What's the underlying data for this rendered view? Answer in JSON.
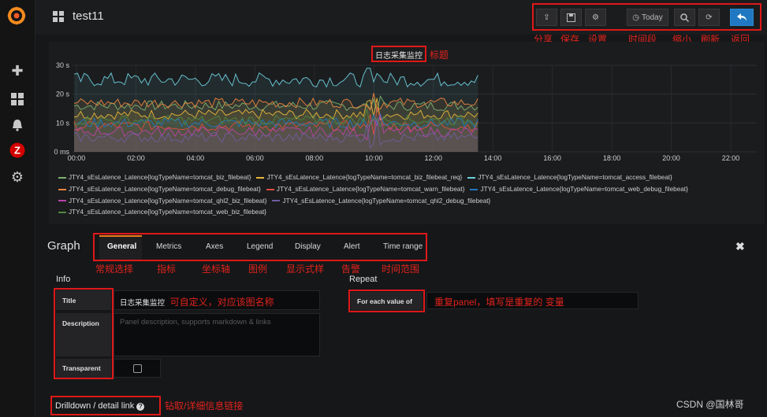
{
  "dashboard": {
    "title": "test11"
  },
  "toolbar": {
    "today_label": "Today",
    "annotations": [
      "分享",
      "保存",
      "设置",
      "时间段",
      "缩小",
      "刷新",
      "返回"
    ]
  },
  "panel": {
    "title": "日志采集监控",
    "title_annotation": "标题"
  },
  "chart_data": {
    "type": "line",
    "x": [
      "00:00",
      "02:00",
      "04:00",
      "06:00",
      "08:00",
      "10:00",
      "12:00",
      "14:00",
      "16:00",
      "18:00",
      "20:00",
      "22:00"
    ],
    "y_ticks": [
      "0 ms",
      "10 s",
      "20 s",
      "30 s"
    ],
    "ylim": [
      0,
      30
    ],
    "data_end": "13:30",
    "grid": true,
    "legend_position": "bottom",
    "series": [
      {
        "name": "JTY4_sEsLatence_Latence{logTypeName=tomcat_biz_filebeat}",
        "color": "#7eb26d",
        "approx_level": 16
      },
      {
        "name": "JTY4_sEsLatence_Latence{logTypeName=tomcat_biz_filebeat_req}",
        "color": "#eab839",
        "approx_level": 13
      },
      {
        "name": "JTY4_sEsLatence_Latence{logTypeName=tomcat_access_filebeat}",
        "color": "#6ed0e0",
        "approx_level": 25
      },
      {
        "name": "JTY4_sEsLatence_Latence{logTypeName=tomcat_debug_filebeat}",
        "color": "#ef843c",
        "approx_level": 17
      },
      {
        "name": "JTY4_sEsLatence_Latence{logTypeName=tomcat_warn_filebeat}",
        "color": "#e24d42",
        "approx_level": 9
      },
      {
        "name": "JTY4_sEsLatence_Latence{logTypeName=tomcat_web_debug_filebeat}",
        "color": "#1f78c1",
        "approx_level": 10
      },
      {
        "name": "JTY4_sEsLatence_Latence{logTypeName=tomcat_qhl2_biz_filebeat}",
        "color": "#ba43a9",
        "approx_level": 7
      },
      {
        "name": "JTY4_sEsLatence_Latence{logTypeName=tomcat_qhl2_debug_filebeat}",
        "color": "#705da0",
        "approx_level": 5
      },
      {
        "name": "JTY4_sEsLatence_Latence{logTypeName=tomcat_web_biz_filebeat}",
        "color": "#508642",
        "approx_level": 11
      }
    ]
  },
  "editor": {
    "panel_type": "Graph",
    "tabs": [
      "General",
      "Metrics",
      "Axes",
      "Legend",
      "Display",
      "Alert",
      "Time range"
    ],
    "tab_annotations": [
      "常规选择",
      "指标",
      "坐标轴",
      "图例",
      "显示式样",
      "告警",
      "时间范围"
    ],
    "info": {
      "heading": "Info",
      "title_label": "Title",
      "title_value": "日志采集监控",
      "title_annotation": "可自定义，对应该图名称",
      "description_label": "Description",
      "description_placeholder": "Panel description, supports markdown & links",
      "transparent_label": "Transparent"
    },
    "repeat": {
      "heading": "Repeat",
      "for_each_label": "For each value of",
      "annotation": "重复panel，填写是重复的 变量"
    },
    "drilldown": {
      "label": "Drilldown / detail link",
      "annotation": "钻取/详细信息链接"
    }
  },
  "watermark": "CSDN @国林哥",
  "colors": {
    "accent": "#eb7b18",
    "back_button": "#1f78c1",
    "annotation_red": "#e0231c"
  }
}
